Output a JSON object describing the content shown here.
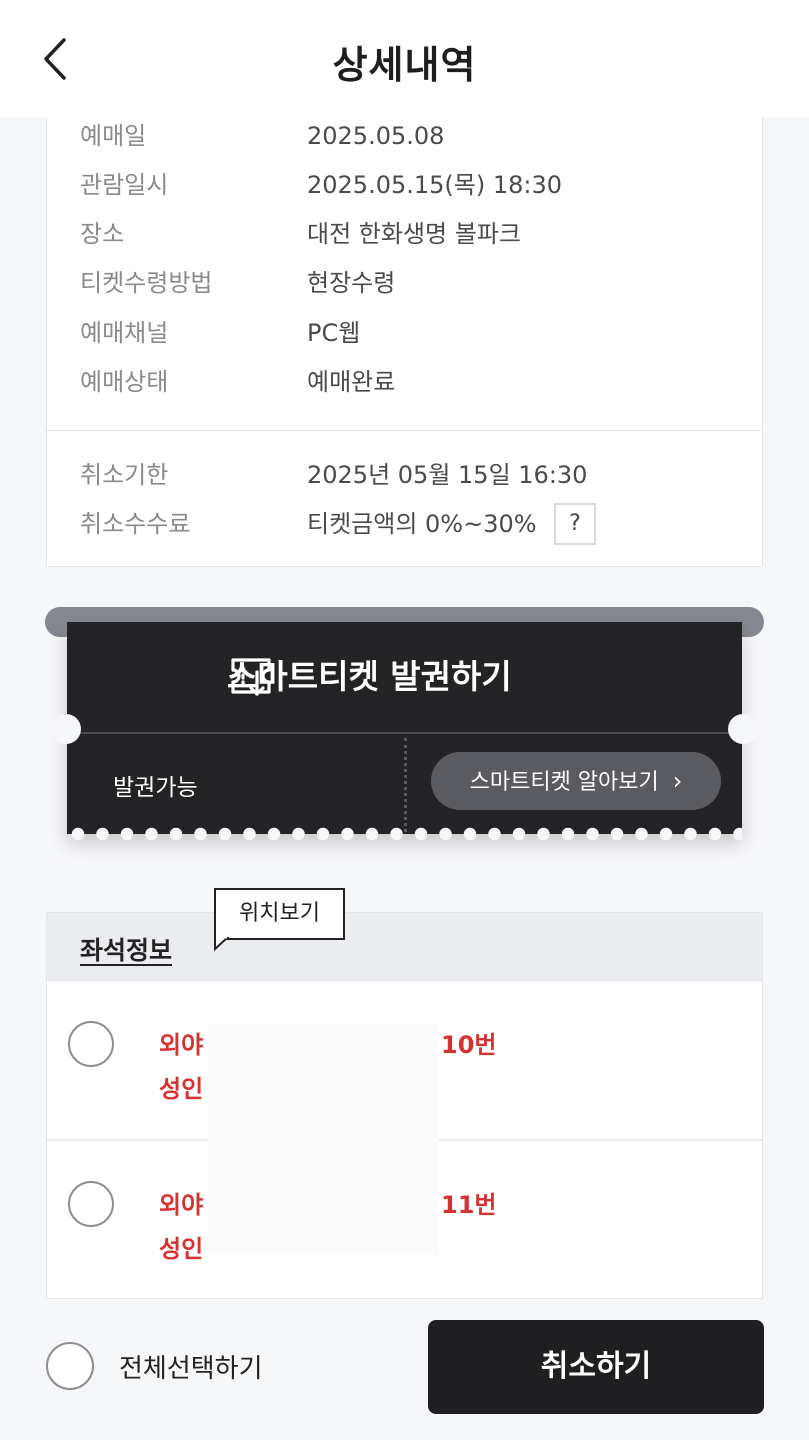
{
  "header": {
    "title": "상세내역"
  },
  "details": [
    {
      "label": "예매일",
      "value": "2025.05.08"
    },
    {
      "label": "관람일시",
      "value": "2025.05.15(목) 18:30"
    },
    {
      "label": "장소",
      "value": "대전 한화생명 볼파크"
    },
    {
      "label": "티켓수령방법",
      "value": "현장수령"
    },
    {
      "label": "예매채널",
      "value": "PC웹"
    },
    {
      "label": "예매상태",
      "value": "예매완료"
    }
  ],
  "cancel_info": [
    {
      "label": "취소기한",
      "value": "2025년 05월 15일 16:30"
    },
    {
      "label": "취소수수료",
      "value": "티켓금액의 0%~30%"
    }
  ],
  "help_button": "?",
  "smart_ticket": {
    "title": "스마트티켓 발권하기",
    "status": "발권가능",
    "learn_more": "스마트티켓 알아보기",
    "icon": "ticket-download-icon"
  },
  "seat_section": {
    "title": "좌석정보",
    "tooltip": "위치보기",
    "seats": [
      {
        "line1": "외야",
        "line2": "성인",
        "number": "10번"
      },
      {
        "line1": "외야",
        "line2": "성인",
        "number": "11번"
      }
    ]
  },
  "footer": {
    "select_all": "전체선택하기",
    "cancel": "취소하기"
  },
  "colors": {
    "accent_red": "#d63232",
    "ticket_dark": "#232326",
    "button_dark": "#1f1f22"
  }
}
